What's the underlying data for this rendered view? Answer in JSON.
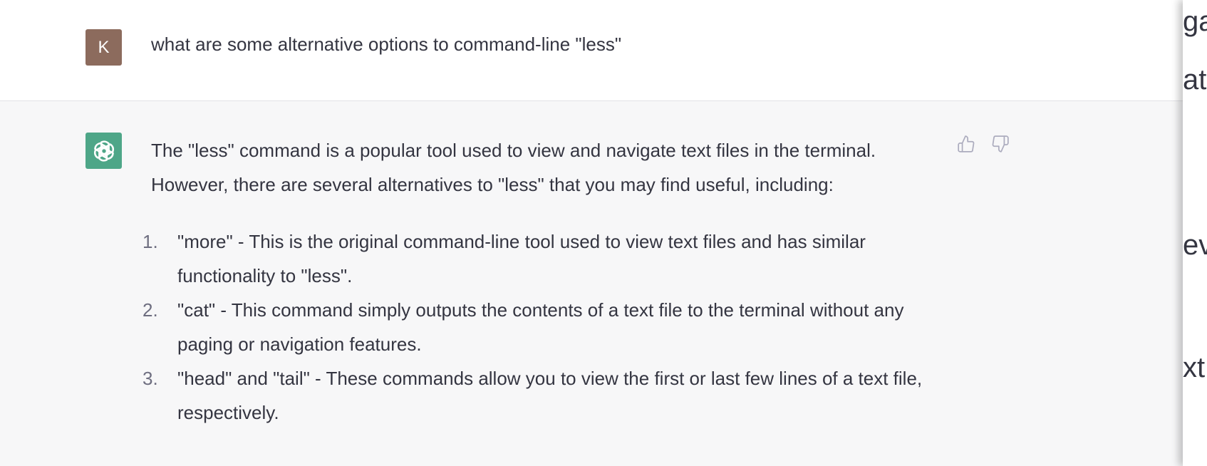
{
  "user_message": {
    "avatar_initial": "K",
    "avatar_color": "#8c6b5d",
    "text": "what are some alternative options to command-line \"less\""
  },
  "assistant_message": {
    "avatar_icon": "openai-logo-icon",
    "avatar_color": "#4ea688",
    "intro": "The \"less\" command is a popular tool used to view and navigate text files in the terminal. However, there are several alternatives to \"less\" that you may find useful, including:",
    "items": [
      {
        "number": "1.",
        "text": "\"more\" - This is the original command-line tool used to view text files and has similar functionality to \"less\"."
      },
      {
        "number": "2.",
        "text": "\"cat\" - This command simply outputs the contents of a text file to the terminal without any paging or navigation features."
      },
      {
        "number": "3.",
        "text": "\"head\" and \"tail\" - These commands allow you to view the first or last few lines of a text file, respectively."
      }
    ],
    "feedback": {
      "thumbs_up_icon": "thumbs-up-icon",
      "thumbs_down_icon": "thumbs-down-icon"
    }
  },
  "right_panel_fragments": [
    "ga",
    "at",
    "ev",
    "xt"
  ]
}
